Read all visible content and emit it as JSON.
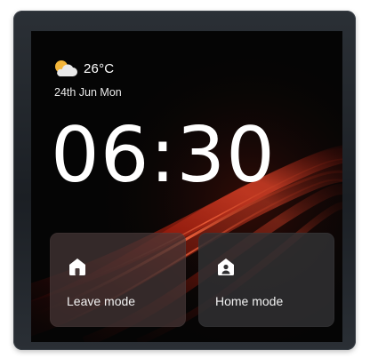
{
  "weather": {
    "temperature": "26°C",
    "icon": "partly-cloudy-icon"
  },
  "date": "24th Jun Mon",
  "time": "06:30",
  "modes": [
    {
      "label": "Leave mode",
      "icon": "home-icon"
    },
    {
      "label": "Home mode",
      "icon": "home-person-icon"
    }
  ],
  "colors": {
    "screen_background": "#050505",
    "accent_swoosh": "#d22b1c",
    "text": "#ffffff",
    "card_background": "#3e3a3a"
  }
}
